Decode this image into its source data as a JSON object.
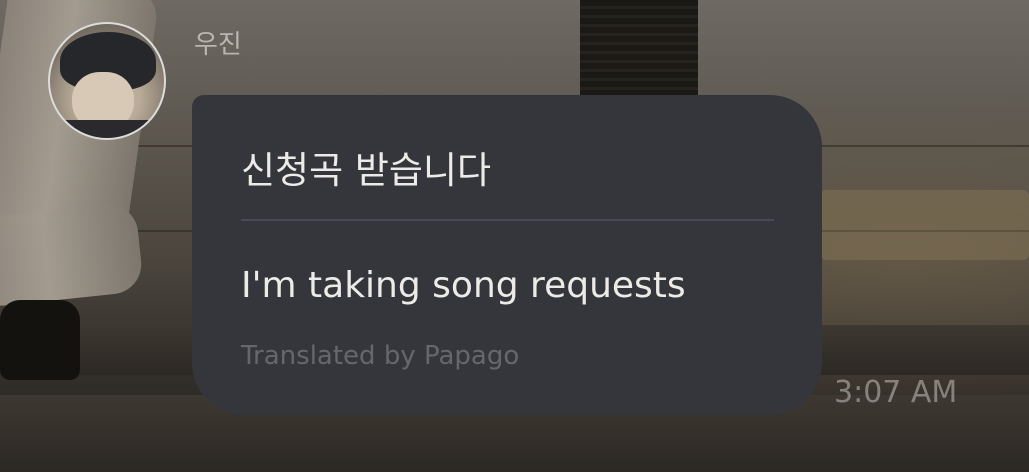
{
  "message": {
    "sender_name": "우진",
    "original_text": "신청곡 받습니다",
    "translated_text": "I'm taking song requests",
    "translation_credit": "Translated by Papago",
    "timestamp": "3:07 AM"
  },
  "colors": {
    "bubble_background": "#35363b",
    "divider": "#4a4b52",
    "primary_text": "#ecebe8",
    "muted_text": "#66676d"
  }
}
